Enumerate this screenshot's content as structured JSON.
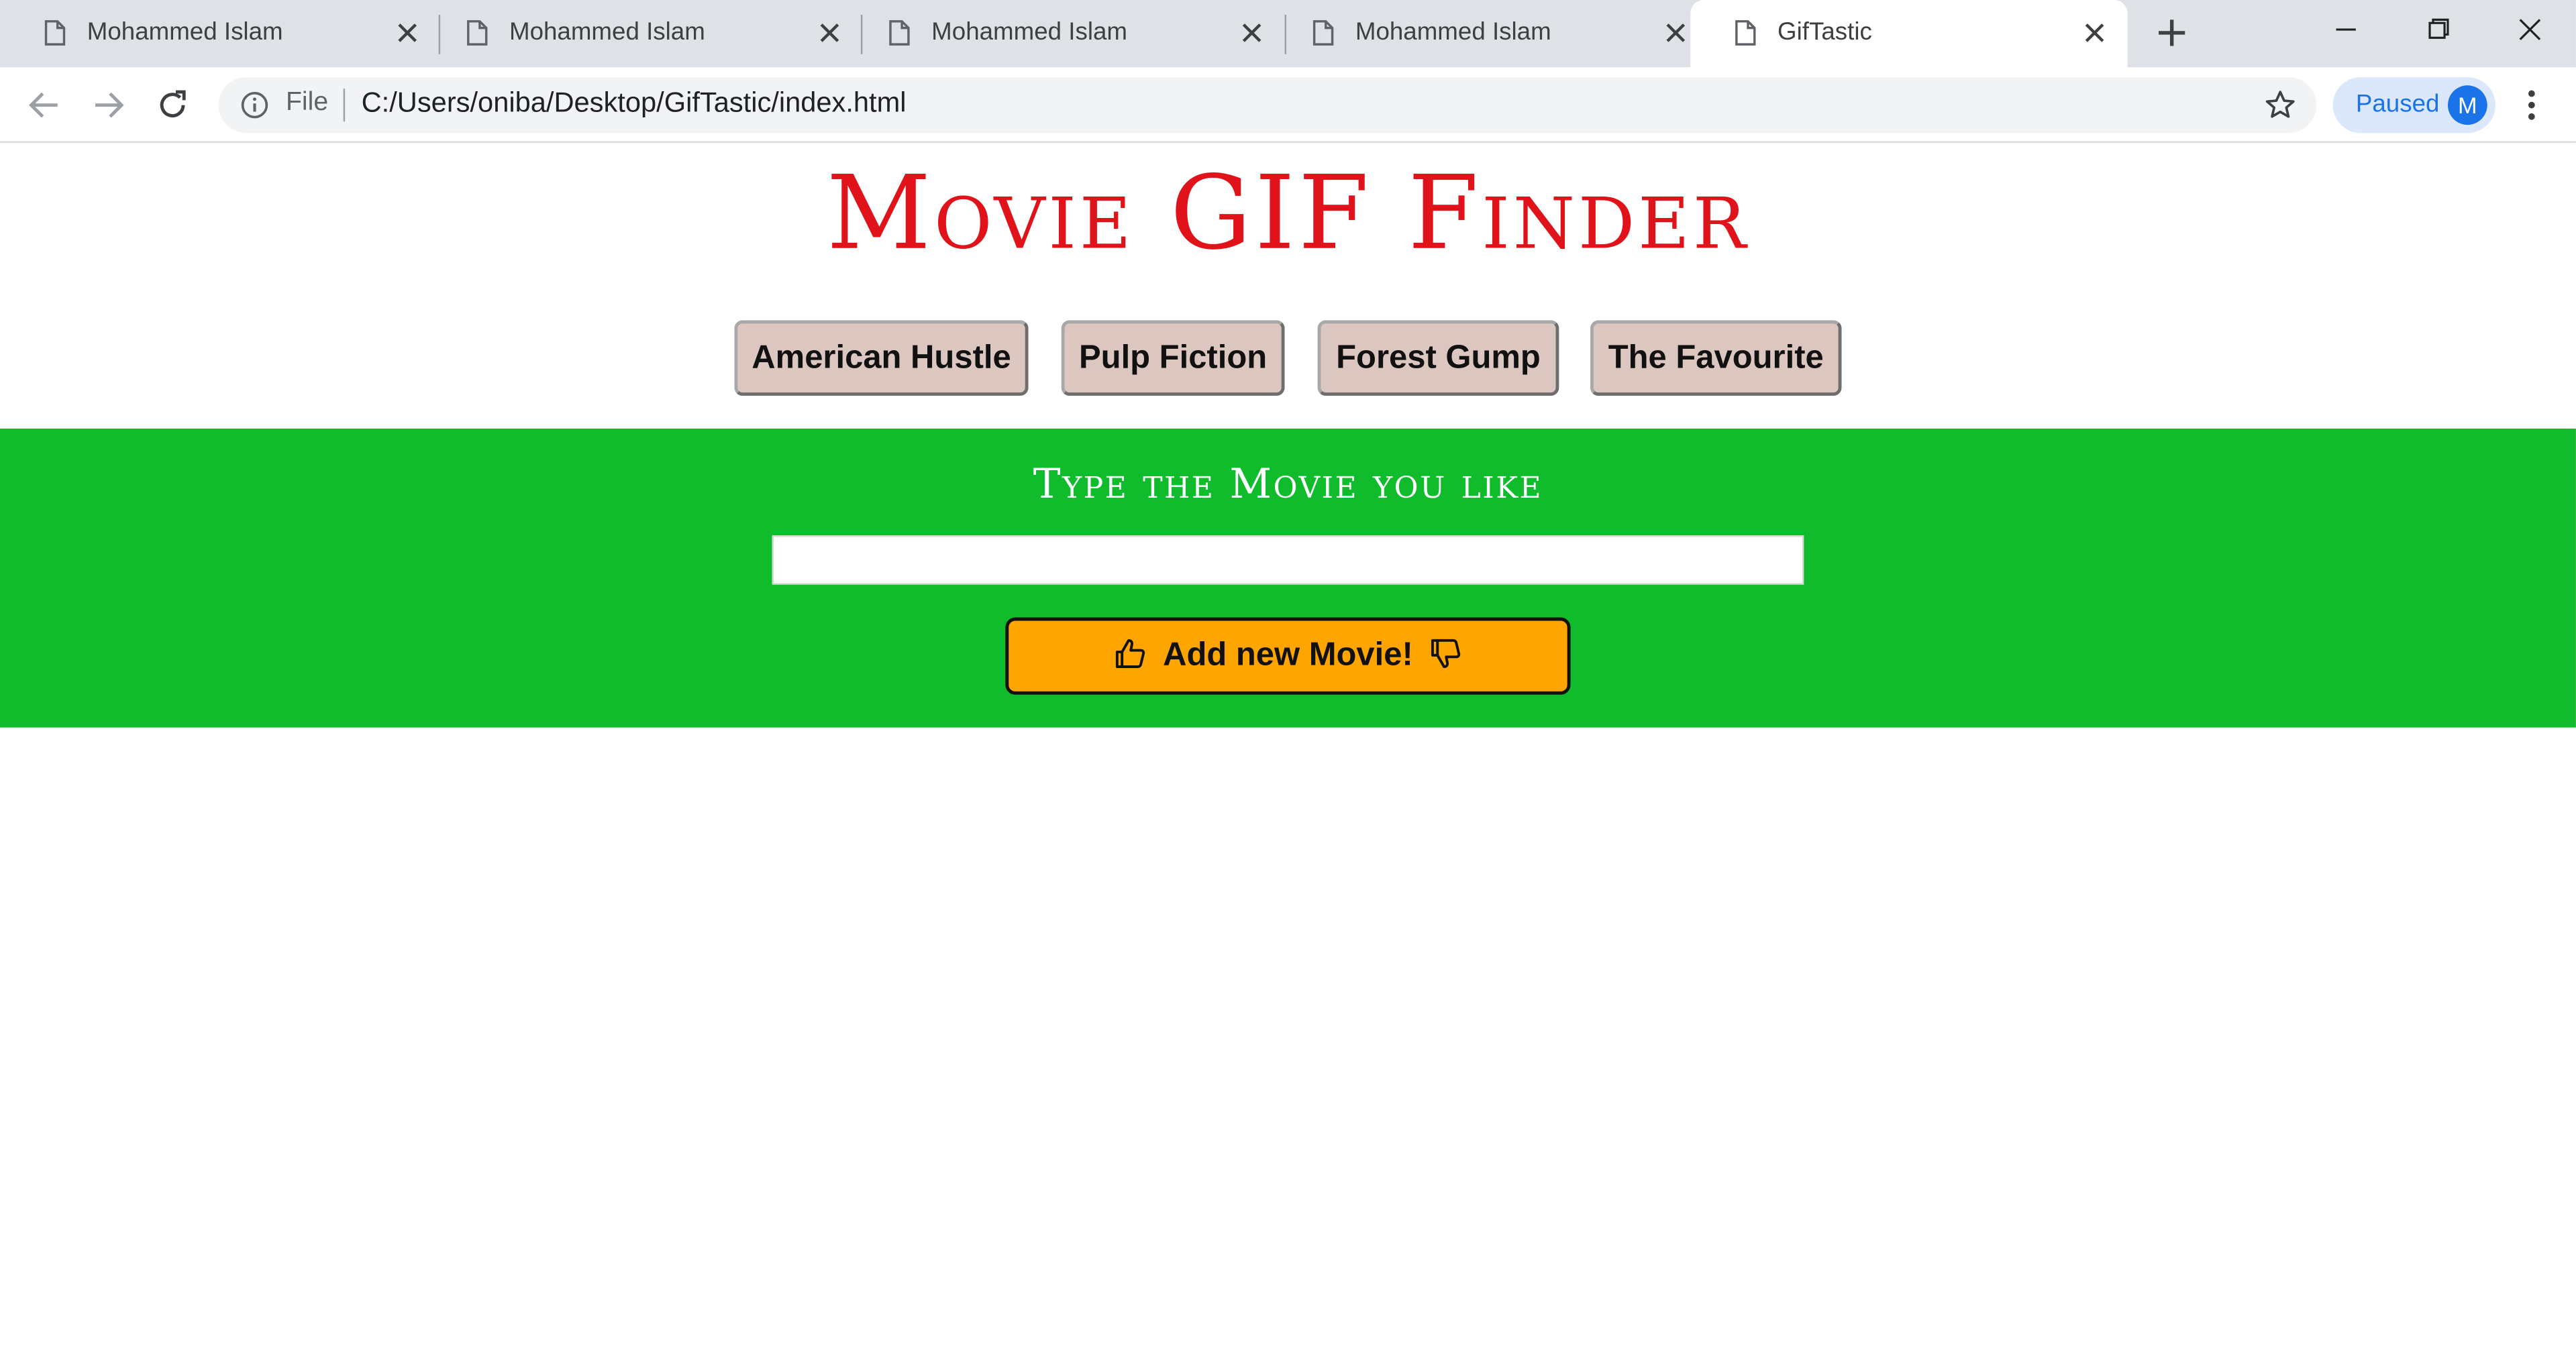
{
  "browser": {
    "tabs": [
      {
        "title": "Mohammed Islam",
        "active": false
      },
      {
        "title": "Mohammed Islam",
        "active": false
      },
      {
        "title": "Mohammed Islam",
        "active": false
      },
      {
        "title": "Mohammed Islam",
        "active": false
      },
      {
        "title": "GifTastic",
        "active": true
      }
    ],
    "address": {
      "scheme_label": "File",
      "url": "C:/Users/oniba/Desktop/GifTastic/index.html"
    },
    "profile": {
      "status": "Paused",
      "initial": "M"
    },
    "colors": {
      "tabstrip": "#dee1e6",
      "profile_accent": "#1a73e8"
    }
  },
  "page": {
    "title": "Movie GIF Finder",
    "movie_buttons": [
      {
        "label": "American Hustle"
      },
      {
        "label": "Pulp Fiction"
      },
      {
        "label": "Forest Gump"
      },
      {
        "label": "The Favourite"
      }
    ],
    "search": {
      "heading": "Type the Movie you like",
      "input_value": "",
      "add_button_label": "Add new Movie!",
      "add_button_icons": [
        "thumbs-up-icon",
        "thumbs-down-icon"
      ]
    },
    "colors": {
      "title": "#e0131b",
      "panel": "#10bb2c",
      "movie_button": "#dcc6c0",
      "add_button": "#ffa500"
    }
  }
}
